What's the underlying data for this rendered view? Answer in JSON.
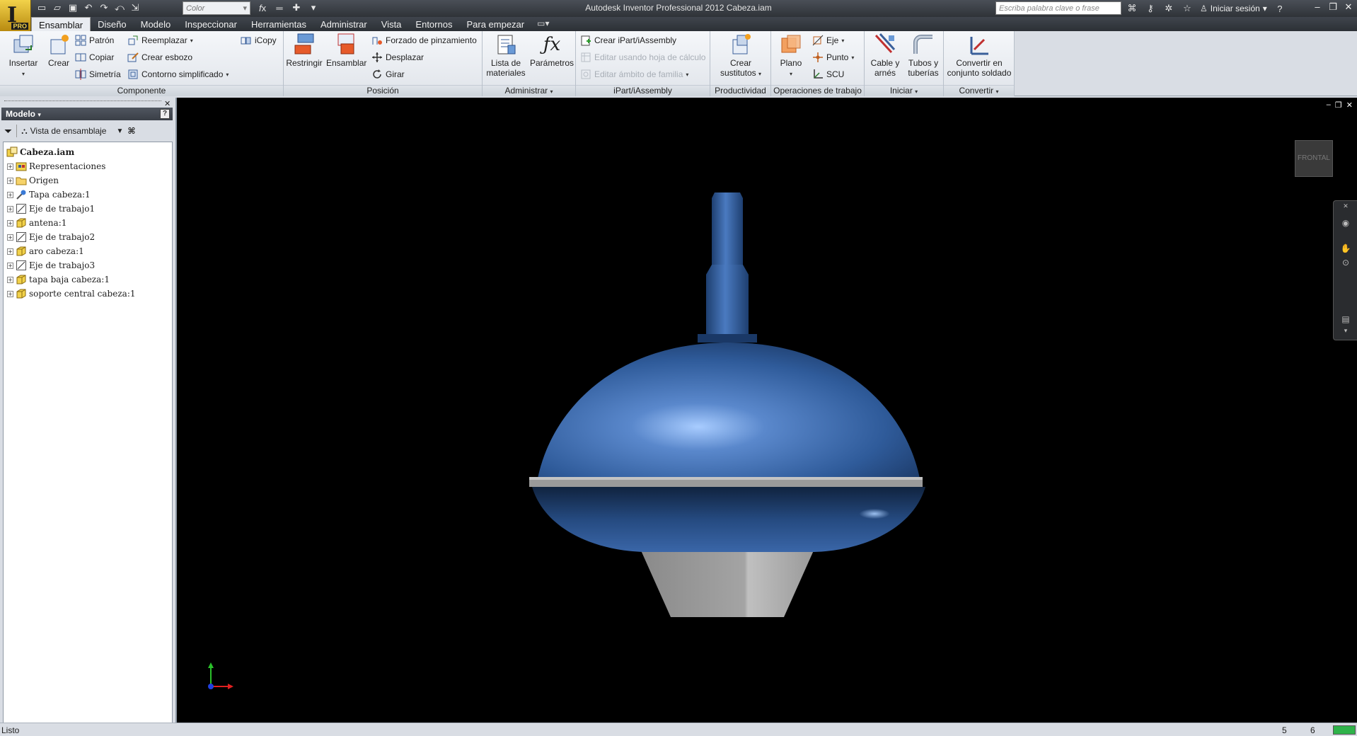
{
  "titlebar": {
    "app_logo_label": "PRO",
    "color_placeholder": "Color",
    "title": "Autodesk Inventor Professional 2012    Cabeza.iam",
    "search_placeholder": "Escriba palabra clave o frase",
    "login_label": "Iniciar sesión"
  },
  "tabs": [
    {
      "label": "Ensamblar",
      "active": true
    },
    {
      "label": "Diseño"
    },
    {
      "label": "Modelo"
    },
    {
      "label": "Inspeccionar"
    },
    {
      "label": "Herramientas"
    },
    {
      "label": "Administrar"
    },
    {
      "label": "Vista"
    },
    {
      "label": "Entornos"
    },
    {
      "label": "Para empezar"
    }
  ],
  "ribbon": {
    "componente": {
      "title": "Componente",
      "insertar": "Insertar",
      "crear": "Crear",
      "patron": "Patrón",
      "copiar": "Copiar",
      "simetria": "Simetría",
      "reemplazar": "Reemplazar",
      "crear_esbozo": "Crear esbozo",
      "contorno": "Contorno simplificado",
      "icopy": "iCopy"
    },
    "posicion": {
      "title": "Posición",
      "restringir": "Restringir",
      "ensamblar": "Ensamblar",
      "forzado": "Forzado de pinzamiento",
      "desplazar": "Desplazar",
      "girar": "Girar"
    },
    "administrar": {
      "title": "Administrar",
      "lista_1": "Lista de",
      "lista_2": "materiales",
      "parametros": "Parámetros"
    },
    "ipart": {
      "title": "iPart/iAssembly",
      "crear": "Crear iPart/iAssembly",
      "editar_hoja": "Editar usando hoja de cálculo",
      "editar_ambito": "Editar ámbito de familia"
    },
    "productividad": {
      "title": "Productividad",
      "crear_1": "Crear",
      "crear_2": "sustitutos"
    },
    "operaciones": {
      "title": "Operaciones de trabajo",
      "plano": "Plano",
      "eje": "Eje",
      "punto": "Punto",
      "scu": "SCU"
    },
    "iniciar": {
      "title": "Iniciar",
      "cable_1": "Cable y",
      "cable_2": "arnés",
      "tubos_1": "Tubos y",
      "tubos_2": "tuberías"
    },
    "convertir": {
      "title": "Convertir",
      "conv_1": "Convertir en",
      "conv_2": "conjunto soldado"
    }
  },
  "browser": {
    "title": "Modelo",
    "view_label": "Vista de ensamblaje",
    "root": "Cabeza.iam",
    "items": [
      {
        "label": "Representaciones",
        "icon": "representations-icon"
      },
      {
        "label": "Origen",
        "icon": "folder-icon"
      },
      {
        "label": "Tapa cabeza:1",
        "icon": "pinned-part-icon"
      },
      {
        "label": "Eje de trabajo1",
        "icon": "work-axis-icon"
      },
      {
        "label": "antena:1",
        "icon": "part-icon"
      },
      {
        "label": "Eje de trabajo2",
        "icon": "work-axis-icon"
      },
      {
        "label": "aro cabeza:1",
        "icon": "part-icon"
      },
      {
        "label": "Eje de trabajo3",
        "icon": "work-axis-icon"
      },
      {
        "label": "tapa baja cabeza:1",
        "icon": "part-icon"
      },
      {
        "label": "soporte central cabeza:1",
        "icon": "part-icon"
      }
    ]
  },
  "viewport": {
    "viewcube_label": "FRONTAL",
    "background": "#000000",
    "model_blue": "#2f5b9a",
    "model_gray": "#9a9a9a"
  },
  "status": {
    "text": "Listo",
    "n1": "5",
    "n2": "6"
  },
  "colors": {
    "accent": "#f2d24a",
    "titlebar": "#2f3338",
    "status_green": "#2fb34a"
  }
}
